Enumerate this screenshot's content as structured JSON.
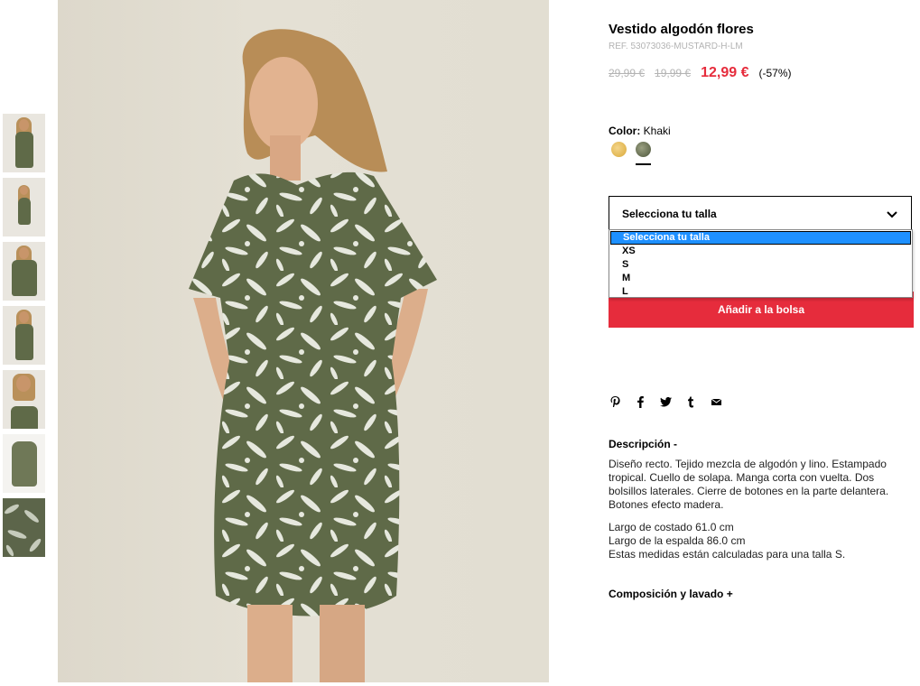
{
  "product": {
    "title": "Vestido algodón flores",
    "ref": "REF. 53073036-MUSTARD-H-LM",
    "prices": [
      "29,99 €",
      "19,99 €"
    ],
    "sale_price": "12,99 €",
    "discount": "(-57%)"
  },
  "color": {
    "label": "Color:",
    "value": "Khaki",
    "swatches": [
      "#e0b24a",
      "#5e6648"
    ]
  },
  "size": {
    "select_label": "Selecciona tu talla",
    "options": [
      "Selecciona tu talla",
      "XS",
      "S",
      "M",
      "L"
    ]
  },
  "cart": {
    "add_label": "Añadir a la bolsa"
  },
  "social": [
    "pinterest-icon",
    "facebook-icon",
    "twitter-icon",
    "tumblr-icon",
    "email-icon"
  ],
  "description": {
    "heading": "Descripción -",
    "text": "Diseño recto. Tejido mezcla de algodón y lino. Estampado tropical. Cuello de solapa. Manga corta con vuelta. Dos bolsillos laterales. Cierre de botones en la parte delantera. Botones efecto madera.",
    "measures": [
      "Largo de costado 61.0 cm",
      "Largo de la espalda 86.0 cm",
      "Estas medidas están calculadas para una talla S."
    ]
  },
  "composition": {
    "heading": "Composición y lavado +"
  },
  "colors": {
    "accent": "#e62c3c",
    "highlight": "#1e90ff",
    "dress": "#5f6a48"
  }
}
